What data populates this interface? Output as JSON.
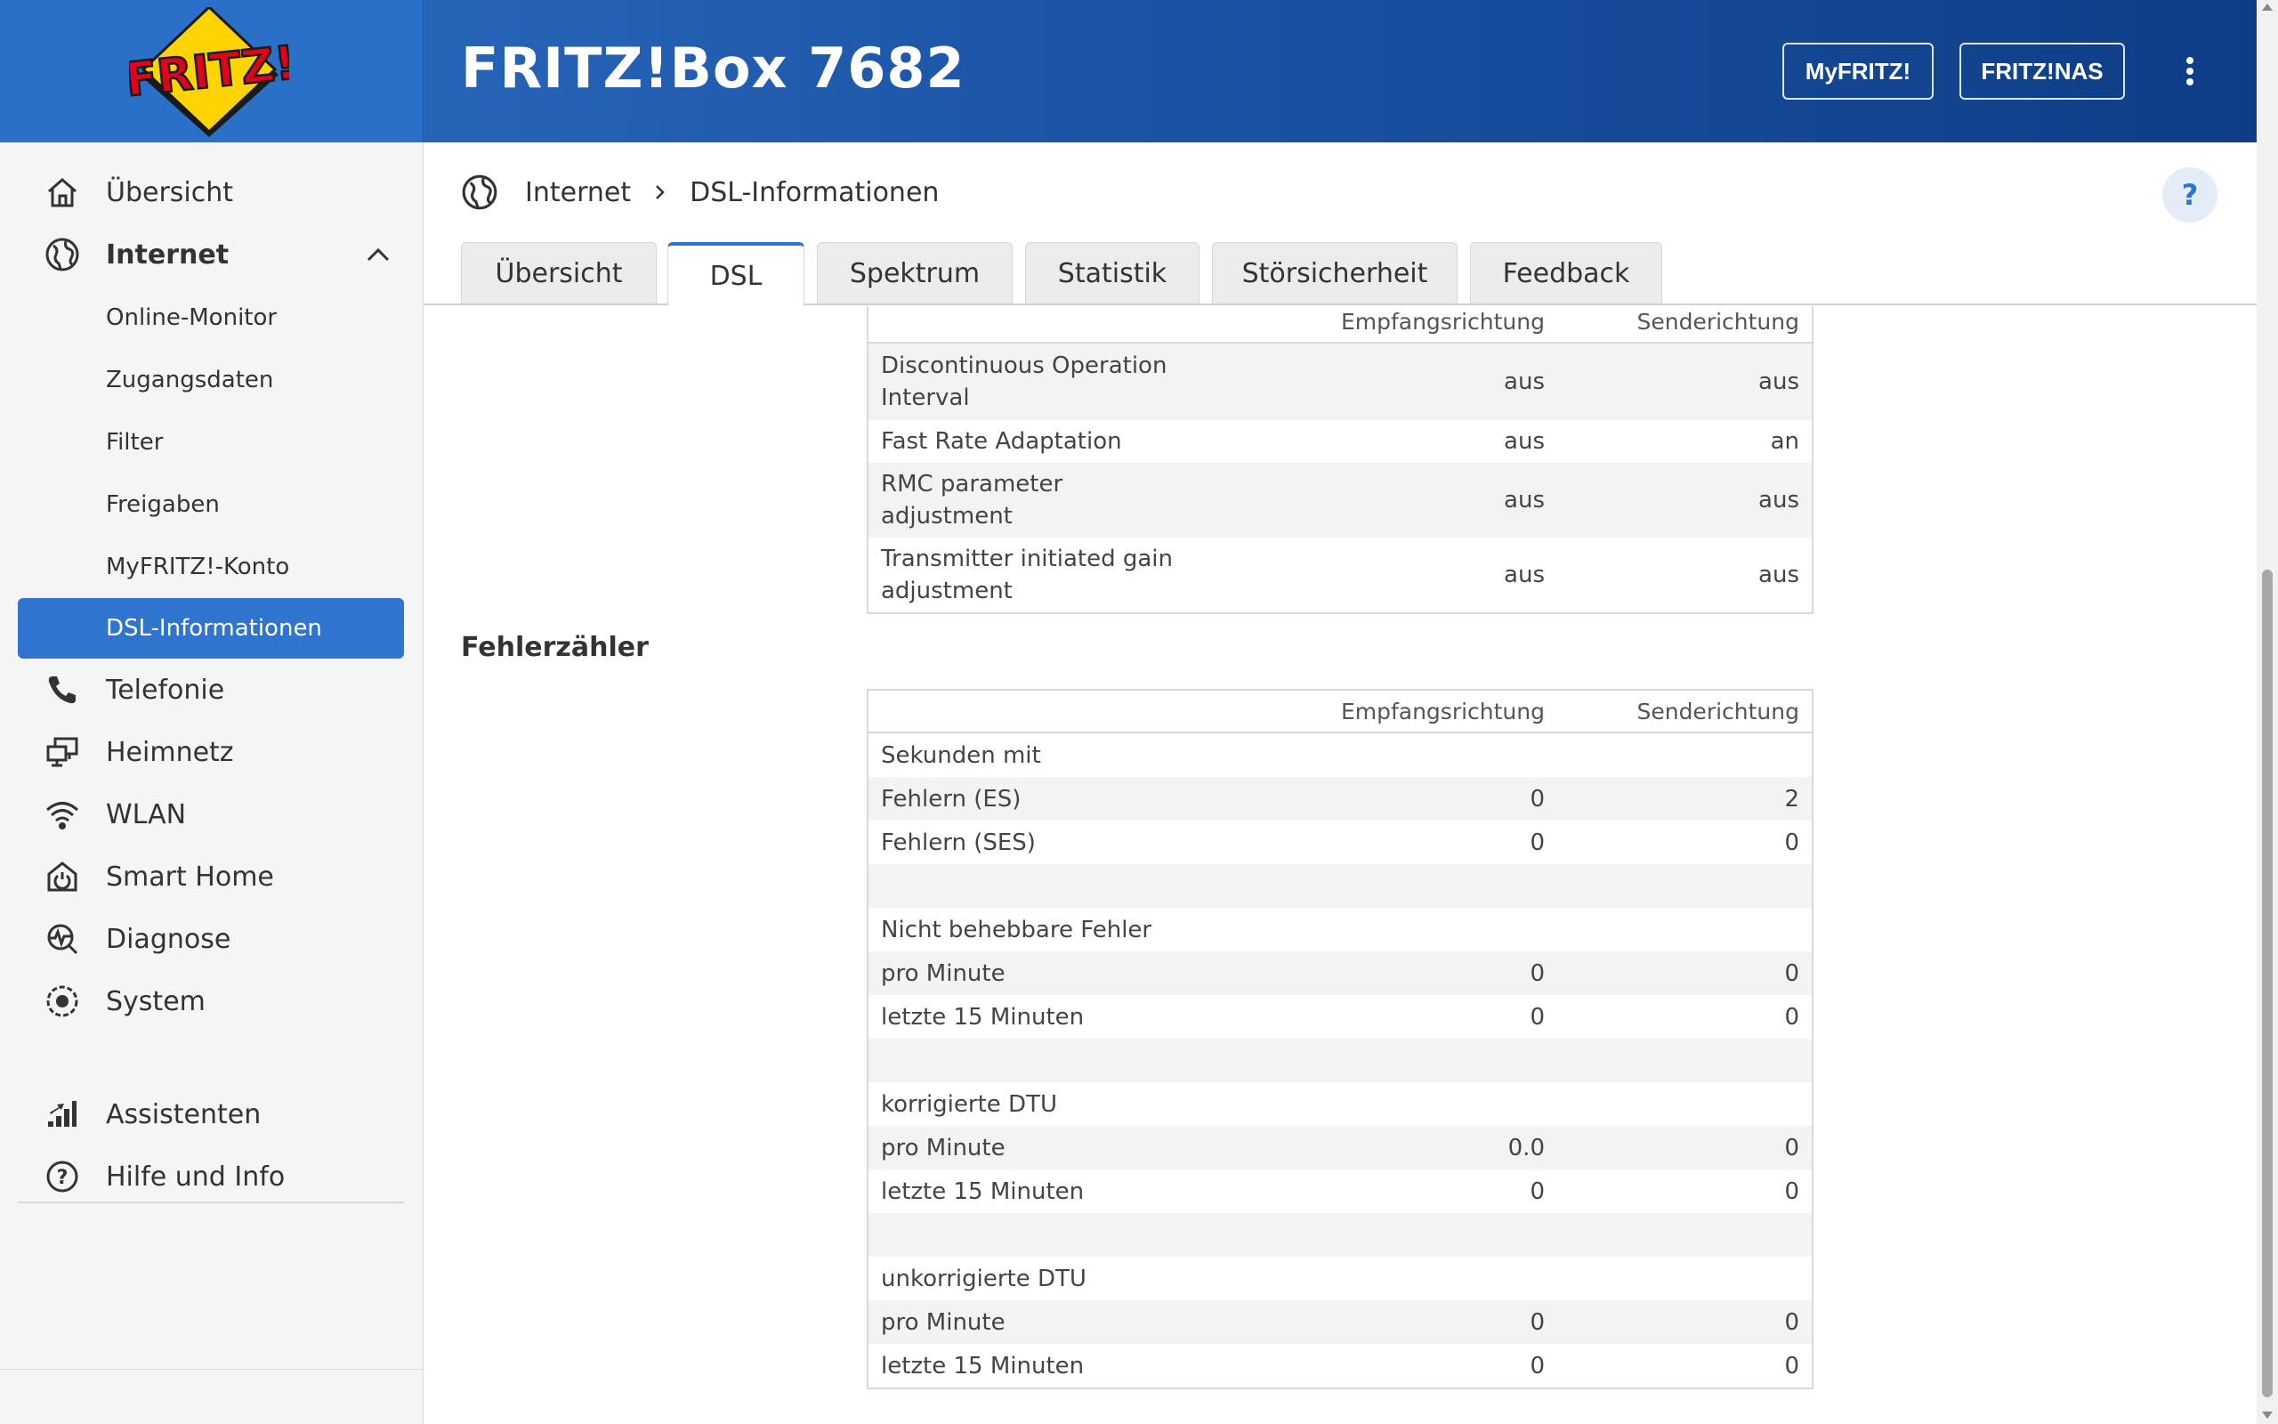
{
  "header": {
    "product_title": "FRITZ!Box 7682",
    "logo_text": "FRITZ!",
    "myfritz_label": "MyFRITZ!",
    "nas_label": "FRITZ!NAS"
  },
  "sidebar": {
    "items": [
      {
        "label": "Übersicht",
        "icon": "home-icon"
      },
      {
        "label": "Internet",
        "icon": "globe-icon",
        "expanded": true
      },
      {
        "label": "Telefonie",
        "icon": "phone-icon"
      },
      {
        "label": "Heimnetz",
        "icon": "network-icon"
      },
      {
        "label": "WLAN",
        "icon": "wifi-icon"
      },
      {
        "label": "Smart Home",
        "icon": "smart-home-icon"
      },
      {
        "label": "Diagnose",
        "icon": "diagnose-icon"
      },
      {
        "label": "System",
        "icon": "system-icon"
      }
    ],
    "internet_subitems": [
      {
        "label": "Online-Monitor"
      },
      {
        "label": "Zugangsdaten"
      },
      {
        "label": "Filter"
      },
      {
        "label": "Freigaben"
      },
      {
        "label": "MyFRITZ!-Konto"
      },
      {
        "label": "DSL-Informationen",
        "active": true
      }
    ],
    "bottom_items": [
      {
        "label": "Assistenten",
        "icon": "wizard-icon"
      },
      {
        "label": "Hilfe und Info",
        "icon": "help-circle-icon"
      }
    ]
  },
  "breadcrumb": {
    "root": "Internet",
    "current": "DSL-Informationen"
  },
  "help_label": "?",
  "tabs": [
    {
      "label": "Übersicht"
    },
    {
      "label": "DSL",
      "active": true
    },
    {
      "label": "Spektrum"
    },
    {
      "label": "Statistik"
    },
    {
      "label": "Störsicherheit"
    },
    {
      "label": "Feedback"
    }
  ],
  "top_table": {
    "headers": [
      "",
      "Empfangsrichtung",
      "Senderichtung"
    ],
    "rows": [
      {
        "label_lines": [
          "Discontinuous Operation",
          "Interval"
        ],
        "rx": "aus",
        "tx": "aus"
      },
      {
        "label_lines": [
          "Fast Rate Adaptation"
        ],
        "rx": "aus",
        "tx": "an"
      },
      {
        "label_lines": [
          "RMC parameter",
          "adjustment"
        ],
        "rx": "aus",
        "tx": "aus"
      },
      {
        "label_lines": [
          "Transmitter initiated gain",
          "adjustment"
        ],
        "rx": "aus",
        "tx": "aus"
      }
    ]
  },
  "error_section": {
    "heading": "Fehlerzähler",
    "headers": [
      "",
      "Empfangsrichtung",
      "Senderichtung"
    ],
    "rows": [
      {
        "label": "Sekunden mit",
        "rx": "",
        "tx": ""
      },
      {
        "label": "Fehlern (ES)",
        "rx": "0",
        "tx": "2"
      },
      {
        "label": "Fehlern (SES)",
        "rx": "0",
        "tx": "0"
      },
      {
        "label": "",
        "rx": "",
        "tx": ""
      },
      {
        "label": "Nicht behebbare Fehler",
        "rx": "",
        "tx": ""
      },
      {
        "label": "pro Minute",
        "rx": "0",
        "tx": "0"
      },
      {
        "label": "letzte 15 Minuten",
        "rx": "0",
        "tx": "0"
      },
      {
        "label": "",
        "rx": "",
        "tx": ""
      },
      {
        "label": "korrigierte DTU",
        "rx": "",
        "tx": ""
      },
      {
        "label": "pro Minute",
        "rx": "0.0",
        "tx": "0"
      },
      {
        "label": "letzte 15 Minuten",
        "rx": "0",
        "tx": "0"
      },
      {
        "label": "",
        "rx": "",
        "tx": ""
      },
      {
        "label": "unkorrigierte DTU",
        "rx": "",
        "tx": ""
      },
      {
        "label": "pro Minute",
        "rx": "0",
        "tx": "0"
      },
      {
        "label": "letzte 15 Minuten",
        "rx": "0",
        "tx": "0"
      }
    ]
  },
  "colors": {
    "header_blue": "#1d56a8",
    "accent_blue": "#2f74cf",
    "logo_yellow": "#ffd400",
    "logo_red": "#e2001a"
  }
}
